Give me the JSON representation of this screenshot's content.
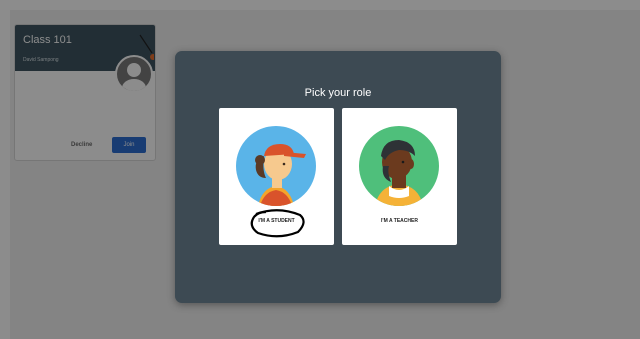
{
  "class_card": {
    "class_name": "Class 101",
    "teacher": "David Sampong",
    "decline_label": "Decline",
    "join_label": "Join"
  },
  "dialog": {
    "title": "Pick your role",
    "roles": [
      {
        "label": "I'M A STUDENT",
        "icon": "student-avatar-icon"
      },
      {
        "label": "I'M A TEACHER",
        "icon": "teacher-avatar-icon"
      }
    ]
  },
  "colors": {
    "card_header": "#3e5562",
    "modal_bg": "#3d4a53",
    "join_button": "#2d6ed2",
    "student_circle": "#5ab4e8",
    "teacher_circle": "#4fbf7b"
  }
}
